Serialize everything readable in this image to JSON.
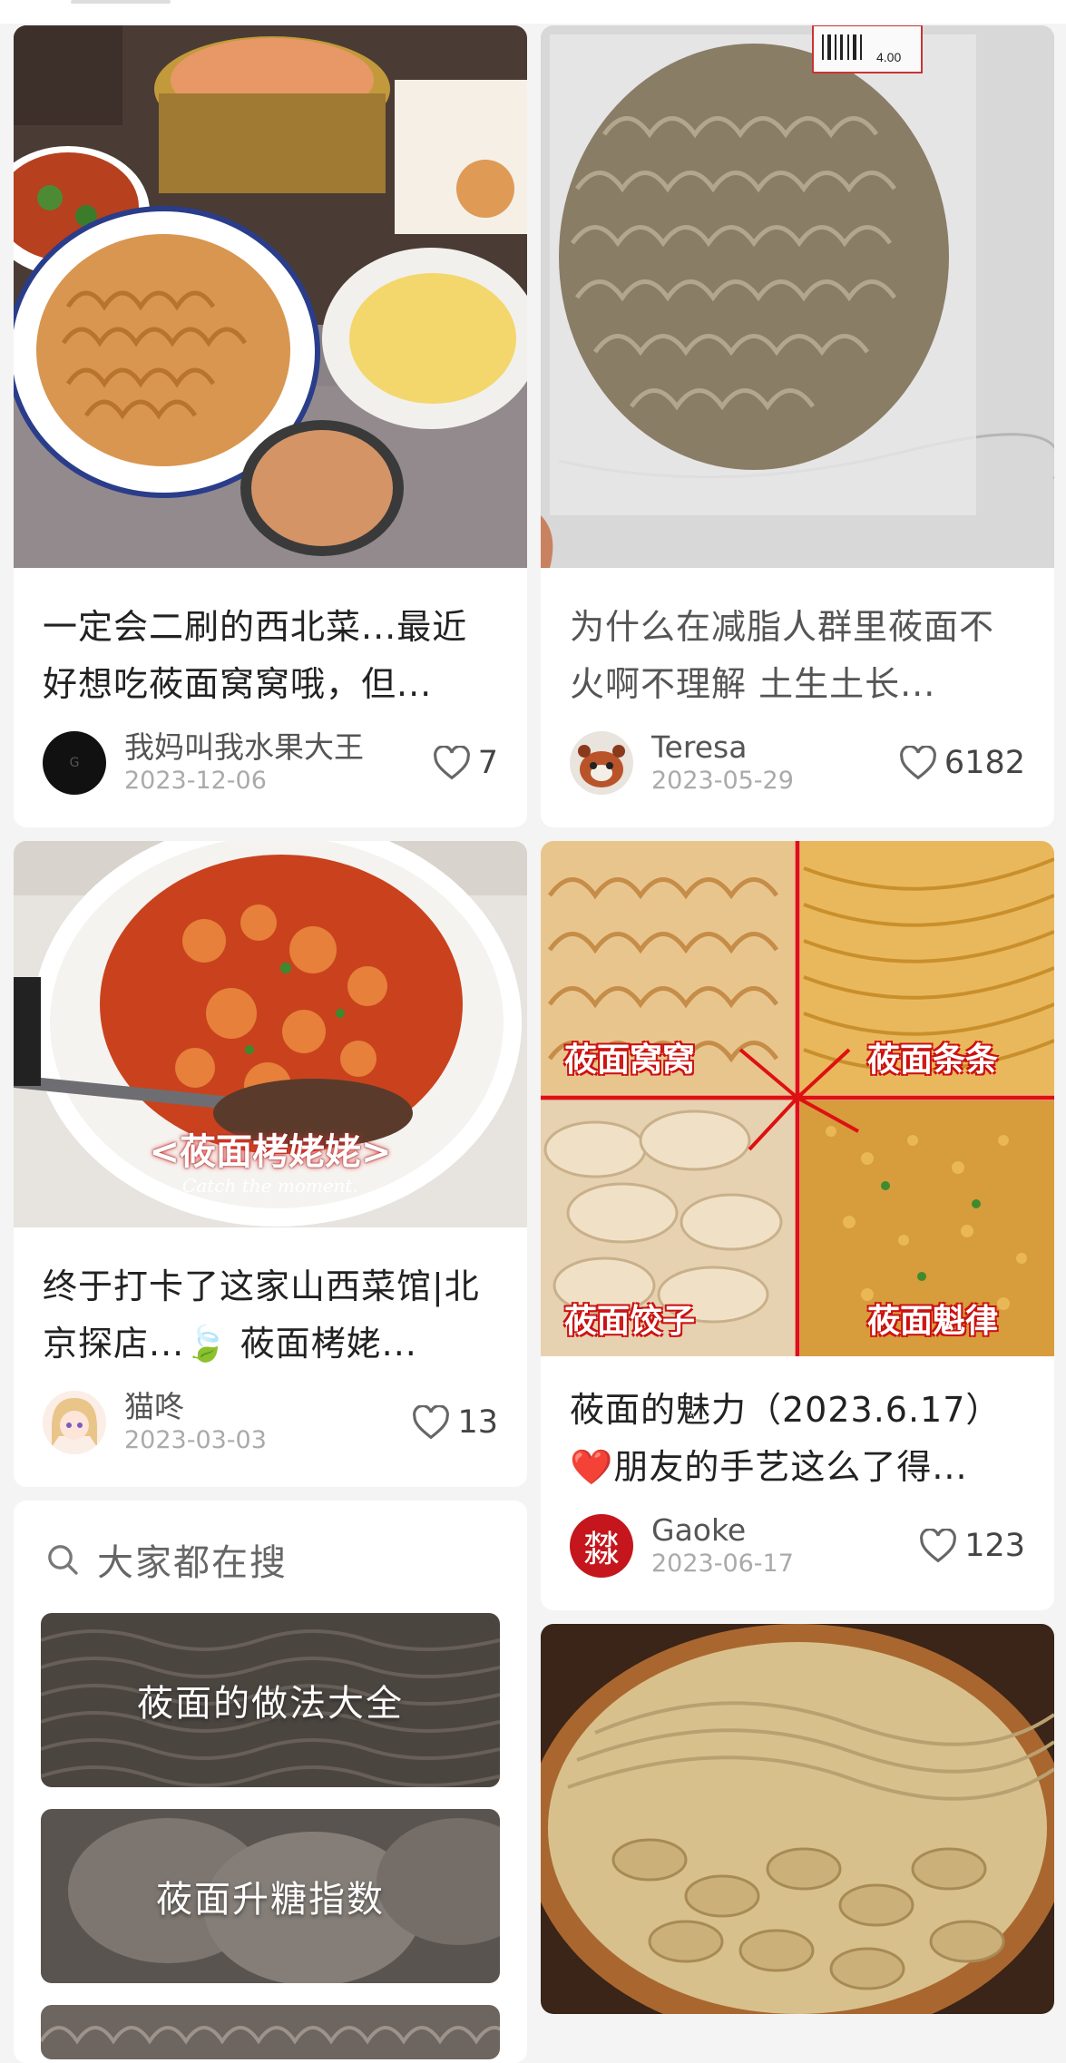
{
  "feed": {
    "left": [
      {
        "title": "一定会二刷的西北菜...最近好想吃莜面窝窝哦，但...",
        "author": "我妈叫我水果大王",
        "date": "2023-12-06",
        "likes": "7",
        "avatar_icon": "black-avatar-icon"
      },
      {
        "title": "终于打卡了这家山西菜馆|北京探店...🍃 莜面栲姥...",
        "author": "猫咚",
        "date": "2023-03-03",
        "likes": "13",
        "image_caption": "<莜面栲姥姥>",
        "image_subcaption": "Catch the moment.",
        "avatar_icon": "anime-girl-avatar-icon"
      }
    ],
    "right": [
      {
        "title": "为什么在减脂人群里莜面不火啊不理解 土生土长...",
        "author": "Teresa",
        "date": "2023-05-29",
        "likes": "6182",
        "image_tag": "4.00",
        "avatar_icon": "red-panda-avatar-icon"
      },
      {
        "title": "莜面的魅力（2023.6.17）❤️朋友的手艺这么了得...",
        "author": "Gaoke",
        "date": "2023-06-17",
        "likes": "123",
        "quad_labels": [
          "莜面窝窝",
          "莜面条条",
          "莜面饺子",
          "莜面魁律"
        ],
        "avatar_icon": "red-seal-avatar-icon",
        "avatar_char": "㵘"
      }
    ]
  },
  "search": {
    "title": "大家都在搜",
    "items": [
      "莜面的做法大全",
      "莜面升糖指数"
    ]
  },
  "colors": {
    "background": "#f4f4f4",
    "card": "#ffffff",
    "like_icon": "#666666"
  }
}
